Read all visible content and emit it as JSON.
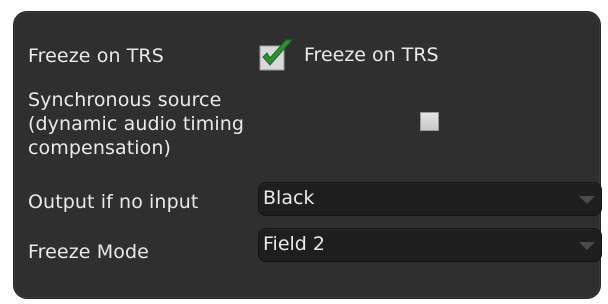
{
  "settings": {
    "freeze_on_trs": {
      "label": "Freeze on TRS",
      "checkbox_label": "Freeze on TRS",
      "checked": true,
      "check_icon": "checkmark-icon",
      "check_color": "#2f8f35"
    },
    "synchronous_source": {
      "label_lines": [
        "Synchronous source",
        "(dynamic audio timing",
        "compensation)"
      ],
      "checked": false
    },
    "output_if_no_input": {
      "label": "Output if no input",
      "value": "Black"
    },
    "freeze_mode": {
      "label": "Freeze Mode",
      "value": "Field 2"
    }
  }
}
